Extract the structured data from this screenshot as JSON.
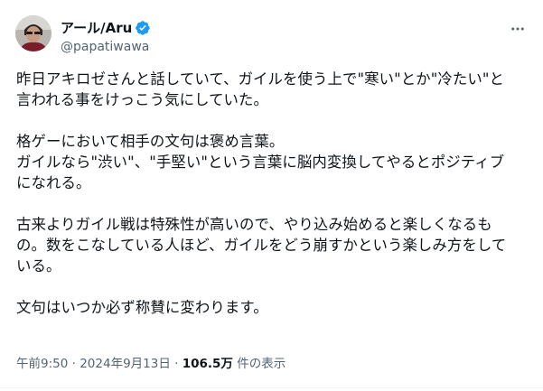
{
  "author": {
    "display_name": "アール/Aru",
    "handle": "@papatiwawa",
    "verified": true,
    "verified_color": "#1d9bf0"
  },
  "more_icon": "more-horizontal-icon",
  "tweet": {
    "paragraphs": [
      "昨日アキロゼさんと話していて、ガイルを使う上で\"寒い\"とか\"冷たい\"と\n言われる事をけっこう気にしていた。",
      "格ゲーにおいて相手の文句は褒め言葉。\nガイルなら\"渋い\"、\"手堅い\"という言葉に脳内変換してやるとポジティブ\nになれる。",
      "古来よりガイル戦は特殊性が高いので、やり込み始めると楽しくなるも\nの。数をこなしている人ほど、ガイルをどう崩すかという楽しみ方をして\nいる。",
      "文句はいつか必ず称賛に変わります。"
    ]
  },
  "meta": {
    "time": "午前9:50",
    "separator": "·",
    "date": "2024年9月13日",
    "views_count": "106.5万",
    "views_label": "件の表示"
  }
}
